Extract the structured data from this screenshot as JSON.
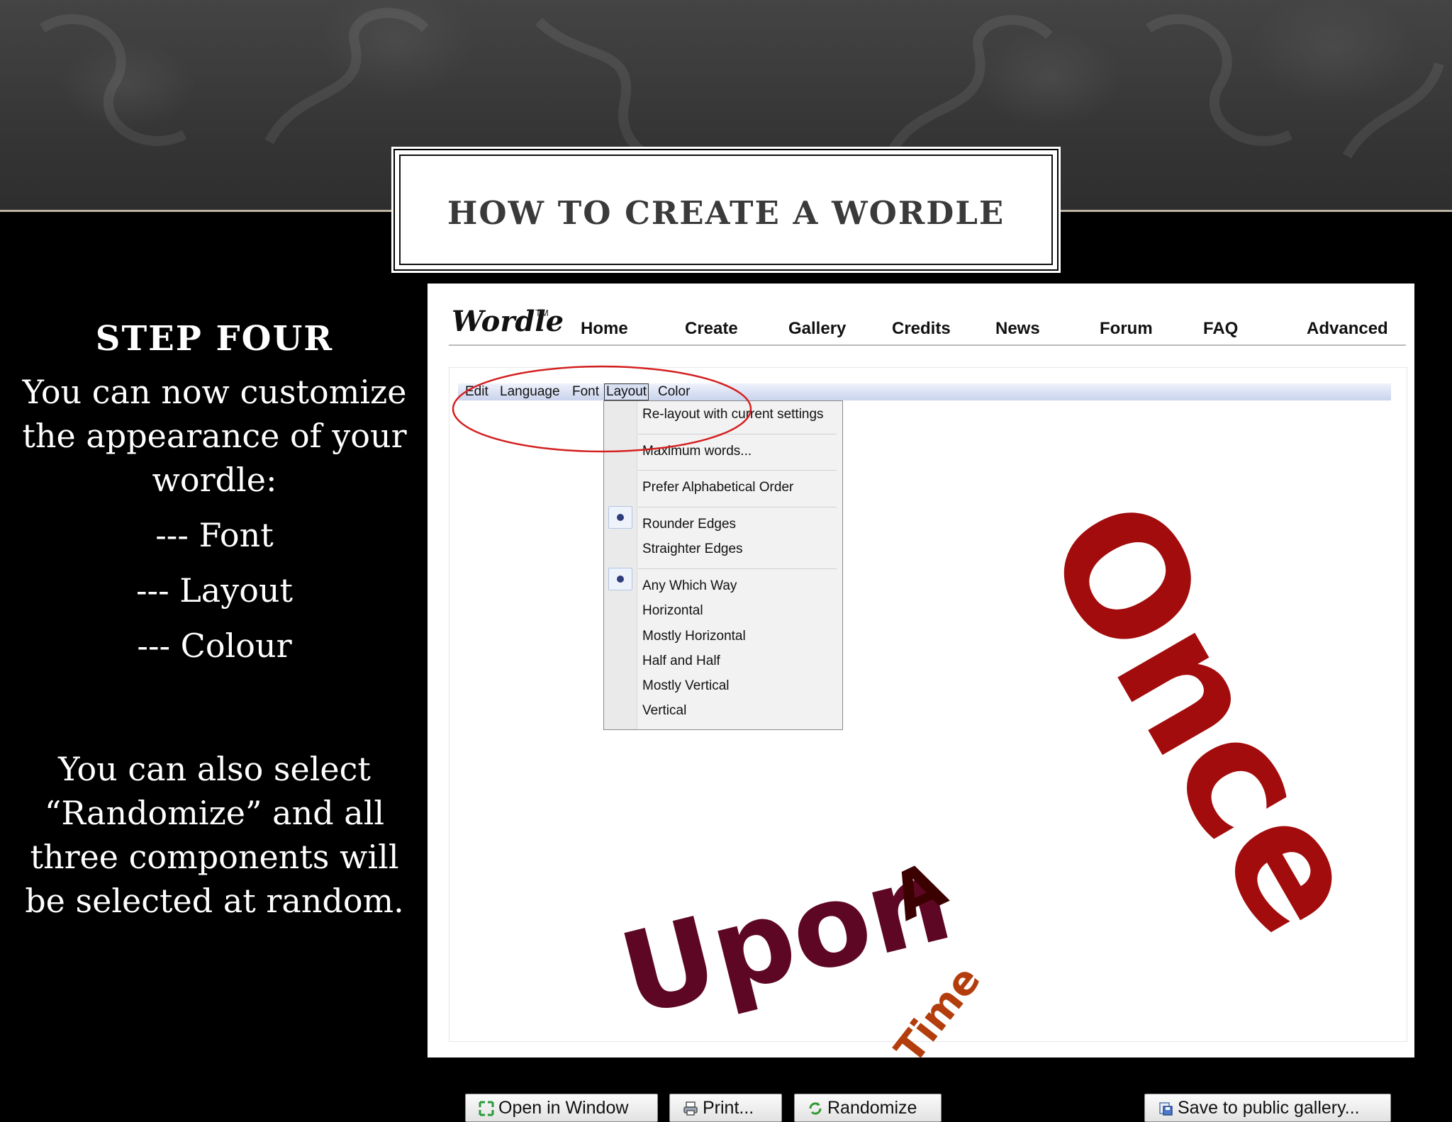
{
  "slide": {
    "title": "HOW TO CREATE A WORDLE",
    "step_heading": "STEP FOUR",
    "intro_lines": [
      "You can now customize",
      "the appearance of  your",
      "wordle:"
    ],
    "options": [
      "--- Font",
      "--- Layout",
      "--- Colour"
    ],
    "note_lines": [
      "You can also select",
      "“Randomize” and all",
      "three components will",
      "be selected at random."
    ]
  },
  "wordle": {
    "logo": "Wordle",
    "trademark": "TM",
    "nav": [
      "Home",
      "Create",
      "Gallery",
      "Credits",
      "News",
      "Forum",
      "FAQ",
      "Advanced"
    ],
    "menubar": [
      "Edit",
      "Language",
      "Font",
      "Layout",
      "Color"
    ],
    "layout_menu": {
      "items": [
        {
          "label": "Re-layout with current settings",
          "selected": false
        },
        {
          "label": "Maximum words...",
          "selected": false
        },
        {
          "label": "Prefer Alphabetical Order",
          "selected": false
        },
        {
          "label": "Rounder Edges",
          "selected": true
        },
        {
          "label": "Straighter Edges",
          "selected": false
        },
        {
          "label": "Any Which Way",
          "selected": true
        },
        {
          "label": "Horizontal",
          "selected": false
        },
        {
          "label": "Mostly Horizontal",
          "selected": false
        },
        {
          "label": "Half and Half",
          "selected": false
        },
        {
          "label": "Mostly Vertical",
          "selected": false
        },
        {
          "label": "Vertical",
          "selected": false
        }
      ]
    },
    "cloud_words": [
      "Once",
      "Upon",
      "A",
      "Time"
    ],
    "buttons": {
      "open_window": "Open in Window",
      "print": "Print...",
      "randomize": "Randomize",
      "save_gallery": "Save to public gallery..."
    },
    "colors": {
      "once": "#a30c0c",
      "upon": "#5e0725",
      "a": "#3b0000",
      "time": "#b33d0d",
      "highlight_oval": "#d42020"
    }
  }
}
